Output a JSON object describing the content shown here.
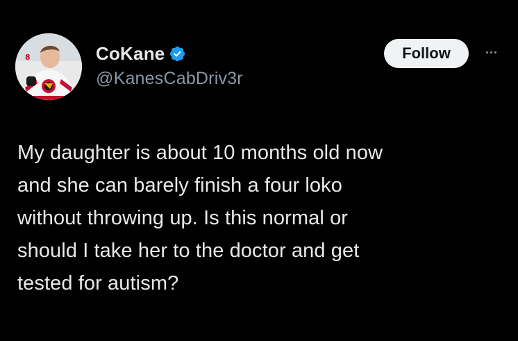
{
  "author": {
    "display_name": "CoKane",
    "handle": "@KanesCabDriv3r",
    "verified": true,
    "avatar_icon": "hockey-player-avatar-icon"
  },
  "actions": {
    "follow_label": "Follow",
    "more_icon": "more-horizontal-icon"
  },
  "tweet": {
    "text": "My daughter is about 10 months old now\nand she can barely finish a four loko\nwithout throwing up. Is this normal or\nshould I take her to the doctor and get\ntested for autism?"
  },
  "colors": {
    "background": "#000000",
    "text": "#e7e9ea",
    "secondary_text": "#8b98a5",
    "verified_badge": "#1d9bf0",
    "follow_button_bg": "#eff3f4",
    "follow_button_text": "#0f1419"
  }
}
